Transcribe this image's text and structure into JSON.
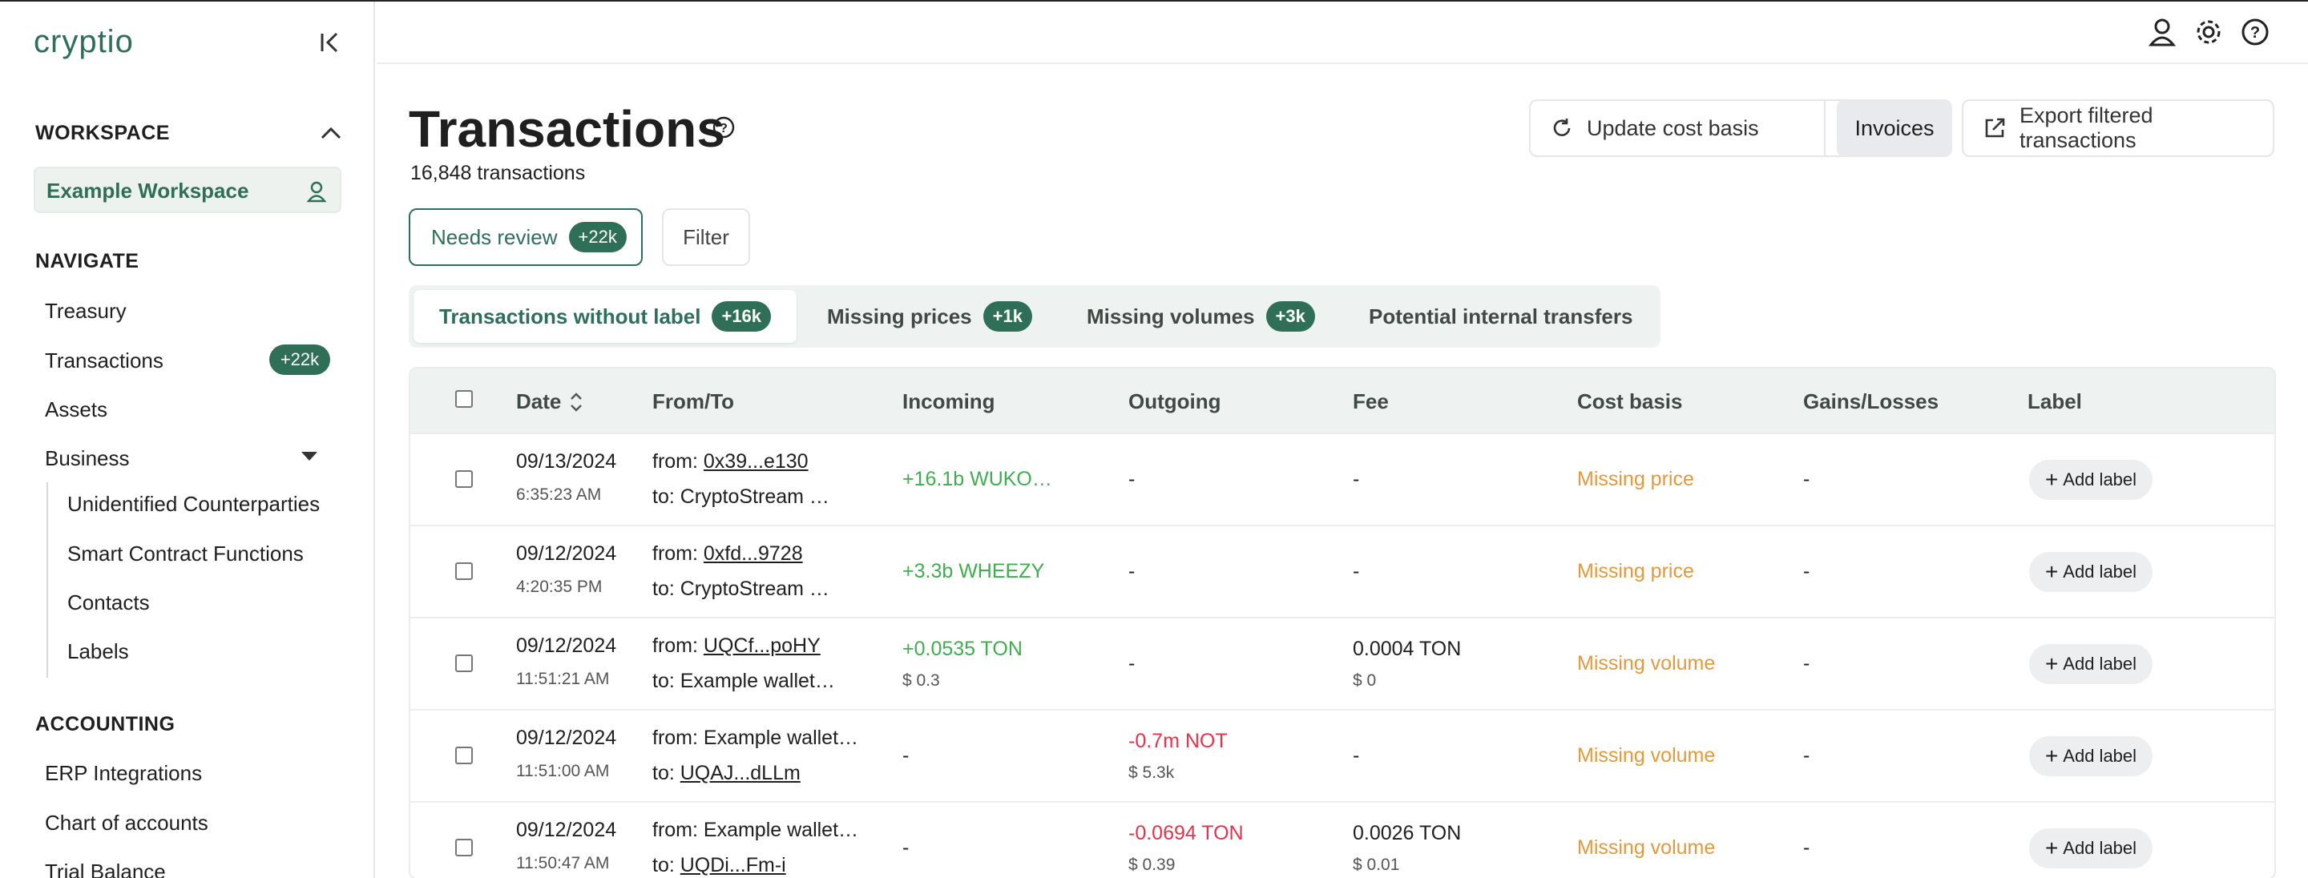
{
  "app": {
    "logo": "cryptio"
  },
  "sidebar": {
    "workspace_header": "WORKSPACE",
    "workspace_name": "Example Workspace",
    "navigate_header": "NAVIGATE",
    "nav": {
      "treasury": "Treasury",
      "transactions": "Transactions",
      "transactions_badge": "+22k",
      "assets": "Assets",
      "business": "Business"
    },
    "business_sub": {
      "unidentified": "Unidentified Counterparties",
      "smart_contract": "Smart Contract Functions",
      "contacts": "Contacts",
      "labels": "Labels"
    },
    "accounting_header": "ACCOUNTING",
    "accounting": {
      "erp": "ERP Integrations",
      "coa": "Chart of accounts",
      "trial_balance": "Trial Balance"
    }
  },
  "page": {
    "title": "Transactions",
    "count": "16,848 transactions"
  },
  "actions": {
    "update_cost_basis": "Update cost basis",
    "invoices": "Invoices",
    "export": "Export filtered transactions"
  },
  "filters": {
    "needs_review": "Needs review",
    "needs_review_badge": "+22k",
    "filter": "Filter"
  },
  "tabs": {
    "without_label": "Transactions without label",
    "without_label_badge": "+16k",
    "missing_prices": "Missing prices",
    "missing_prices_badge": "+1k",
    "missing_volumes": "Missing volumes",
    "missing_volumes_badge": "+3k",
    "internal": "Potential internal transfers"
  },
  "table": {
    "headers": {
      "date": "Date",
      "from_to": "From/To",
      "incoming": "Incoming",
      "outgoing": "Outgoing",
      "fee": "Fee",
      "cost_basis": "Cost basis",
      "gains": "Gains/Losses",
      "label": "Label"
    },
    "add_label": "Add label",
    "rows": [
      {
        "date": "09/13/2024",
        "time": "6:35:23 AM",
        "from_prefix": "from: ",
        "from": "0x39...e130",
        "to_prefix": "to: ",
        "to": "CryptoStream …",
        "incoming": "+16.1b WUKO…",
        "incoming_usd": "",
        "outgoing": "-",
        "outgoing_usd": "",
        "fee": "-",
        "fee_usd": "",
        "cost_basis": "Missing price",
        "gains": "-"
      },
      {
        "date": "09/12/2024",
        "time": "4:20:35 PM",
        "from_prefix": "from: ",
        "from": "0xfd...9728",
        "to_prefix": "to: ",
        "to": "CryptoStream …",
        "incoming": "+3.3b WHEEZY",
        "incoming_usd": "",
        "outgoing": "-",
        "outgoing_usd": "",
        "fee": "-",
        "fee_usd": "",
        "cost_basis": "Missing price",
        "gains": "-"
      },
      {
        "date": "09/12/2024",
        "time": "11:51:21 AM",
        "from_prefix": "from: ",
        "from": "UQCf...poHY",
        "to_prefix": "to: ",
        "to": "Example wallet…",
        "incoming": "+0.0535 TON",
        "incoming_usd": "$ 0.3",
        "outgoing": "-",
        "outgoing_usd": "",
        "fee": "0.0004 TON",
        "fee_usd": "$ 0",
        "cost_basis": "Missing volume",
        "gains": "-"
      },
      {
        "date": "09/12/2024",
        "time": "11:51:00 AM",
        "from_prefix": "from: ",
        "from": "Example wallet…",
        "to_prefix": "to: ",
        "to": "UQAJ...dLLm",
        "incoming": "-",
        "incoming_usd": "",
        "outgoing": "-0.7m NOT",
        "outgoing_usd": "$ 5.3k",
        "fee": "-",
        "fee_usd": "",
        "cost_basis": "Missing volume",
        "gains": "-"
      },
      {
        "date": "09/12/2024",
        "time": "11:50:47 AM",
        "from_prefix": "from: ",
        "from": "Example wallet…",
        "to_prefix": "to: ",
        "to": "UQDi...Fm-i",
        "incoming": "-",
        "incoming_usd": "",
        "outgoing": "-0.0694 TON",
        "outgoing_usd": "$ 0.39",
        "fee": "0.0026 TON",
        "fee_usd": "$ 0.01",
        "cost_basis": "Missing volume",
        "gains": "-"
      }
    ]
  },
  "colors": {
    "brand": "#2f6f57",
    "positive": "#3fae4f",
    "negative": "#e3344c",
    "warning": "#e29a3a"
  },
  "icons": [
    "collapse-sidebar-icon",
    "chevron-up-icon",
    "user-icon",
    "gear-icon",
    "help-icon",
    "refresh-icon",
    "chevron-down-icon",
    "external-link-icon",
    "sort-icon",
    "plus-icon"
  ]
}
